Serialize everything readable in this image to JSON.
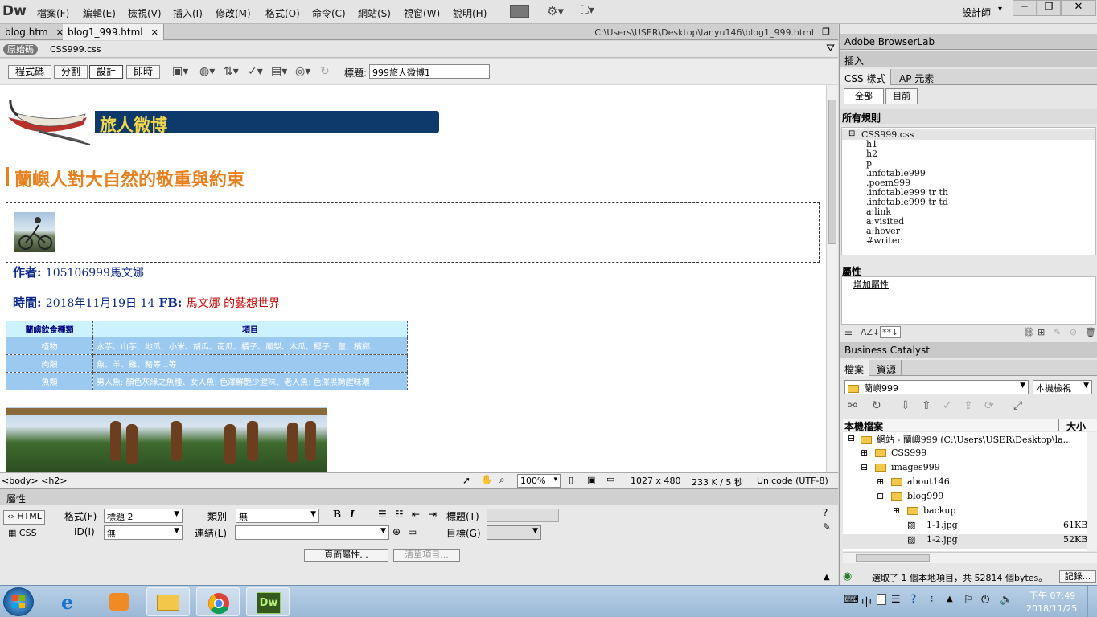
{
  "app": {
    "logo": "Dw",
    "workspace": "設計師"
  },
  "menu": [
    "檔案(F)",
    "編輯(E)",
    "檢視(V)",
    "插入(I)",
    "修改(M)",
    "格式(O)",
    "命令(C)",
    "網站(S)",
    "視窗(W)",
    "說明(H)"
  ],
  "tabs": [
    {
      "label": "blog.htm"
    },
    {
      "label": "blog1_999.html"
    }
  ],
  "doc_path": "C:\\Users\\USER\\Desktop\\lanyu146\\blog1_999.html",
  "related": {
    "source": "原始碼",
    "file": "CSS999.css"
  },
  "toolbar": {
    "views": [
      "程式碼",
      "分割",
      "設計",
      "即時"
    ],
    "title_label": "標題:",
    "title_value": "999旅人微博1"
  },
  "page": {
    "banner": "旅人微博",
    "heading": "蘭嶼人對大自然的敬重與約束",
    "author_label": "作者:",
    "author_value": "105106999馬文娜",
    "time_label": "時間:",
    "time_value": "2018年11月19日 14",
    "fb_label": "FB:",
    "fb_value": "馬文娜 的藝想世界",
    "table": {
      "headers": [
        "蘭嶼飲食種類",
        "項目"
      ],
      "rows": [
        [
          "植物",
          "水芋、山芋、地瓜、小米、胡瓜、南瓜、橘子、鳳梨、木瓜、椰子、薑、檳榔..."
        ],
        [
          "肉類",
          "魚、羊、雞、豬等...等"
        ],
        [
          "魚類",
          "男人魚: 顏色灰綠之魚種、女人魚: 色澤鮮艷少腥味、老人魚: 色澤黑黝腥味濃"
        ]
      ]
    }
  },
  "status": {
    "tags": "<body> <h2>",
    "zoom": "100%",
    "size": "1027 x 480",
    "weight": "233 K / 5 秒",
    "encoding": "Unicode (UTF-8)"
  },
  "props": {
    "title": "屬性",
    "html_btn": "HTML",
    "css_btn": "CSS",
    "format_label": "格式(F)",
    "format_value": "標題 2",
    "class_label": "類別",
    "class_value": "無",
    "id_label": "ID(I)",
    "id_value": "無",
    "link_label": "連結(L)",
    "title_label": "標題(T)",
    "target_label": "目標(G)",
    "bold": "B",
    "italic": "I",
    "page_props": "頁面屬性...",
    "list_item": "清單項目..."
  },
  "panels": {
    "browserlab": "Adobe BrowserLab",
    "insert": "插入",
    "css_tab": "CSS 樣式",
    "ap_tab": "AP 元素",
    "all_btn": "全部",
    "current_btn": "目前",
    "all_rules": "所有規則",
    "css_file": "CSS999.css",
    "rules": [
      "h1",
      "h2",
      "p",
      ".infotable999",
      ".poem999",
      ".infotable999 tr th",
      ".infotable999 tr td",
      "a:link",
      "a:visited",
      "a:hover",
      "#writer"
    ],
    "props_title": "屬性",
    "add_prop": "增加屬性",
    "bc": "Business Catalyst",
    "files_tab": "檔案",
    "assets_tab": "資源",
    "site_select": "蘭嶼999",
    "view_select": "本機檢視",
    "col_local": "本機檔案",
    "col_size": "大小",
    "tree": [
      {
        "label": "網站 - 蘭嶼999 (C:\\Users\\USER\\Desktop\\la...",
        "size": ""
      },
      {
        "label": "CSS999",
        "size": ""
      },
      {
        "label": "images999",
        "size": ""
      },
      {
        "label": "about146",
        "size": ""
      },
      {
        "label": "blog999",
        "size": ""
      },
      {
        "label": "backup",
        "size": ""
      },
      {
        "label": "1-1.jpg",
        "size": "61KB"
      },
      {
        "label": "1-2.jpg",
        "size": "52KB"
      }
    ],
    "status_text": "選取了 1 個本地項目，共 52814 個bytes。",
    "log_btn": "記錄..."
  },
  "taskbar": {
    "time": "下午 07:49",
    "date": "2018/11/25",
    "ime": "中"
  }
}
